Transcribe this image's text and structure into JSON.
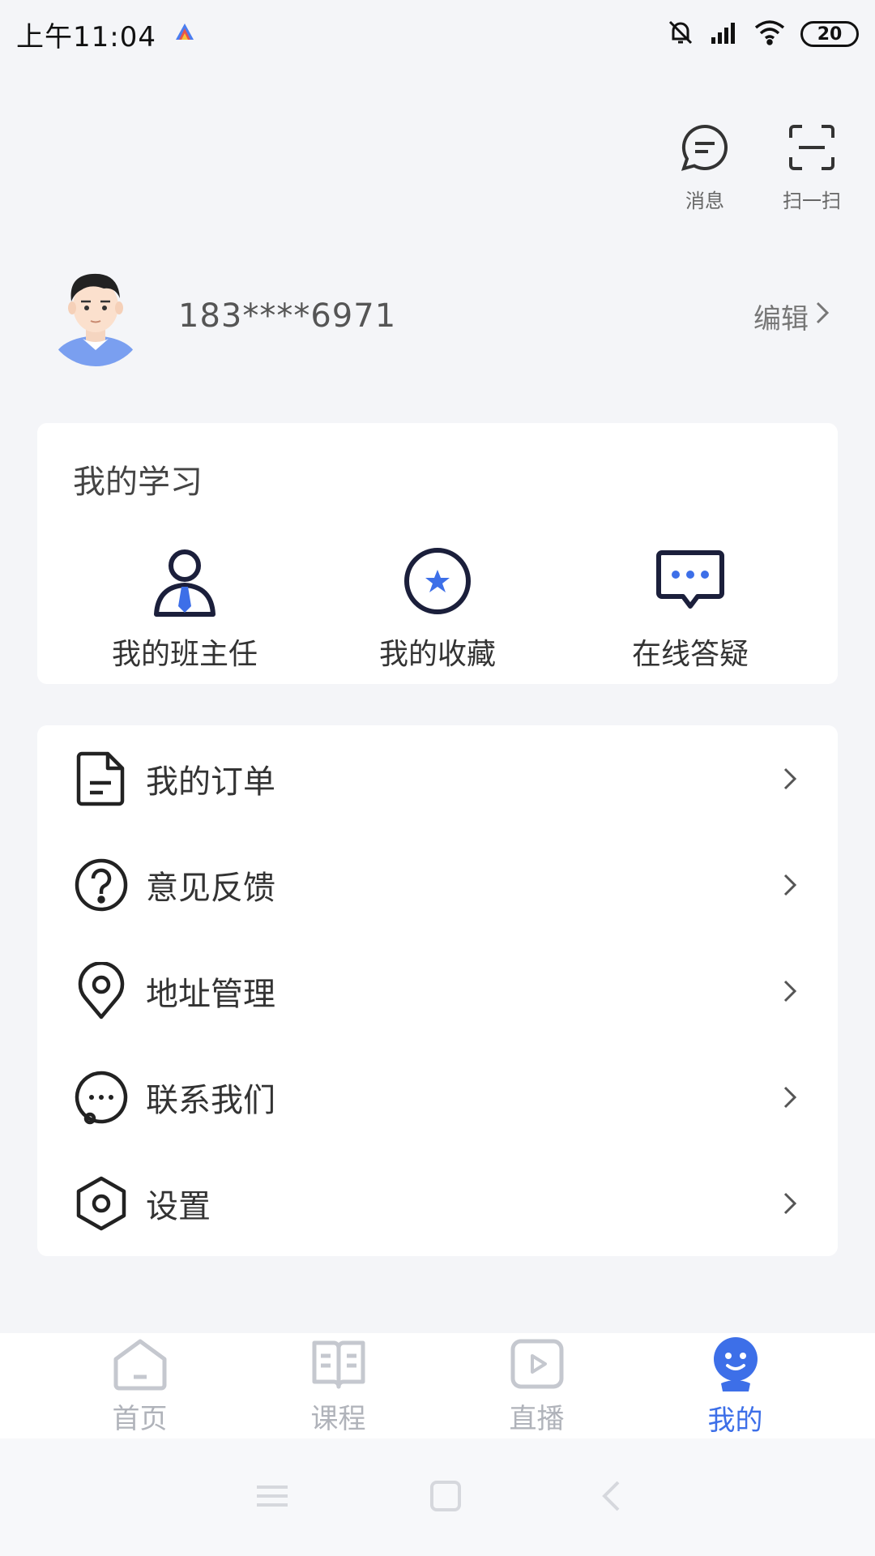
{
  "status_bar": {
    "time": "上午11:04",
    "battery": "20"
  },
  "top_actions": [
    {
      "label": "消息",
      "icon": "message-icon"
    },
    {
      "label": "扫一扫",
      "icon": "scan-icon"
    }
  ],
  "profile": {
    "phone": "183****6971",
    "edit_label": "编辑"
  },
  "study": {
    "title": "我的学习",
    "items": [
      {
        "label": "我的班主任",
        "icon": "head-teacher-icon"
      },
      {
        "label": "我的收藏",
        "icon": "favorites-star-icon"
      },
      {
        "label": "在线答疑",
        "icon": "online-qa-icon"
      }
    ]
  },
  "menu": {
    "items": [
      {
        "label": "我的订单",
        "icon": "order-document-icon"
      },
      {
        "label": "意见反馈",
        "icon": "feedback-question-icon"
      },
      {
        "label": "地址管理",
        "icon": "location-pin-icon"
      },
      {
        "label": "联系我们",
        "icon": "contact-chat-icon"
      },
      {
        "label": "设置",
        "icon": "settings-hexagon-icon"
      }
    ]
  },
  "tabs": [
    {
      "label": "首页",
      "icon": "home-icon",
      "active": false
    },
    {
      "label": "课程",
      "icon": "course-book-icon",
      "active": false
    },
    {
      "label": "直播",
      "icon": "live-play-icon",
      "active": false
    },
    {
      "label": "我的",
      "icon": "mine-face-icon",
      "active": true
    }
  ],
  "colors": {
    "accent": "#3d6fe8",
    "background": "#f4f5f8",
    "tab_inactive": "#b0b3ba",
    "battery_low": "#e53935"
  }
}
